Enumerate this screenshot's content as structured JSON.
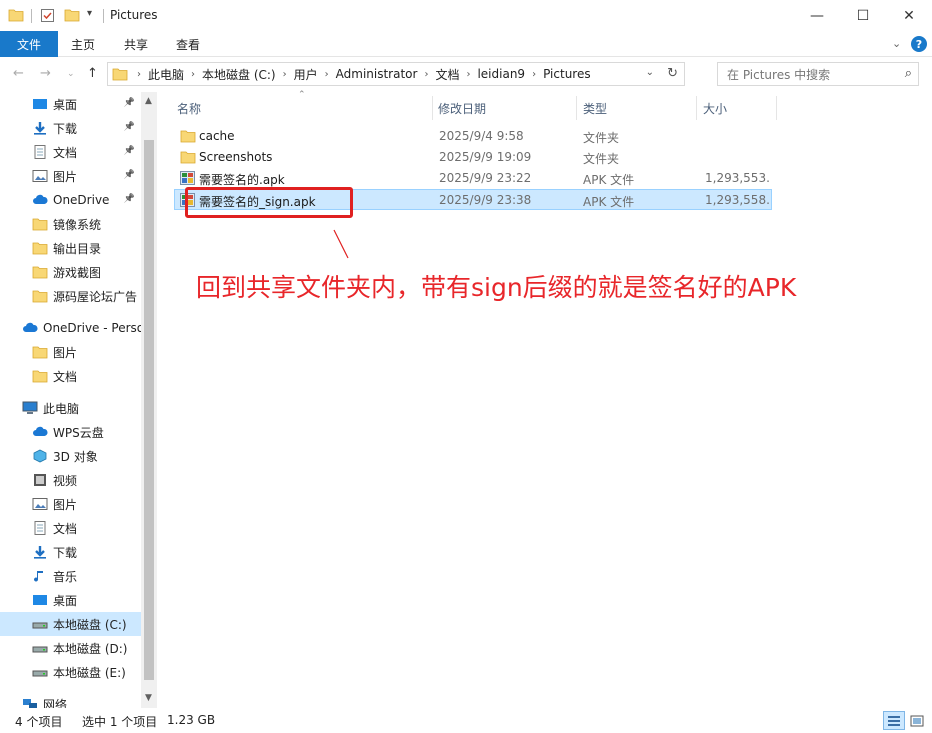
{
  "window": {
    "title": "Pictures",
    "minimize": "—",
    "maximize": "☐",
    "close": "✕"
  },
  "ribbon": {
    "tabs": [
      {
        "label": "文件"
      },
      {
        "label": "主页"
      },
      {
        "label": "共享"
      },
      {
        "label": "查看"
      }
    ],
    "help": "?"
  },
  "address": {
    "crumbs": [
      "此电脑",
      "本地磁盘 (C:)",
      "用户",
      "Administrator",
      "文档",
      "leidian9",
      "Pictures"
    ]
  },
  "search": {
    "placeholder": "在 Pictures 中搜索"
  },
  "sidebar": {
    "items": [
      {
        "label": "桌面",
        "icon": "desktop-icon",
        "pinned": true
      },
      {
        "label": "下载",
        "icon": "download-icon",
        "pinned": true
      },
      {
        "label": "文档",
        "icon": "document-icon",
        "pinned": true
      },
      {
        "label": "图片",
        "icon": "picture-icon",
        "pinned": true
      },
      {
        "label": "OneDrive",
        "icon": "cloud-icon",
        "pinned": true
      },
      {
        "label": "镜像系统",
        "icon": "folder-icon",
        "pinned": false
      },
      {
        "label": "输出目录",
        "icon": "folder-icon",
        "pinned": false
      },
      {
        "label": "游戏截图",
        "icon": "folder-icon",
        "pinned": false
      },
      {
        "label": "源码屋论坛广告",
        "icon": "folder-icon",
        "pinned": false
      },
      {
        "label": "OneDrive - Perso",
        "icon": "cloud-icon",
        "pinned": false
      },
      {
        "label": "图片",
        "icon": "folder-icon",
        "pinned": false
      },
      {
        "label": "文档",
        "icon": "folder-icon",
        "pinned": false
      },
      {
        "label": "此电脑",
        "icon": "computer-icon",
        "pinned": false
      },
      {
        "label": "WPS云盘",
        "icon": "cloud-icon",
        "pinned": false
      },
      {
        "label": "3D 对象",
        "icon": "cube-icon",
        "pinned": false
      },
      {
        "label": "视频",
        "icon": "video-icon",
        "pinned": false
      },
      {
        "label": "图片",
        "icon": "picture-icon",
        "pinned": false
      },
      {
        "label": "文档",
        "icon": "document-icon",
        "pinned": false
      },
      {
        "label": "下载",
        "icon": "download-icon",
        "pinned": false
      },
      {
        "label": "音乐",
        "icon": "music-icon",
        "pinned": false
      },
      {
        "label": "桌面",
        "icon": "desktop-icon",
        "pinned": false
      },
      {
        "label": "本地磁盘 (C:)",
        "icon": "drive-icon",
        "pinned": false,
        "selected": true
      },
      {
        "label": "本地磁盘 (D:)",
        "icon": "drive-icon",
        "pinned": false
      },
      {
        "label": "本地磁盘 (E:)",
        "icon": "drive-icon",
        "pinned": false
      },
      {
        "label": "网络",
        "icon": "network-icon",
        "pinned": false
      }
    ]
  },
  "columns": {
    "name": "名称",
    "date": "修改日期",
    "type": "类型",
    "size": "大小"
  },
  "files": [
    {
      "name": "cache",
      "date": "2025/9/4 9:58",
      "type": "文件夹",
      "size": "",
      "icon": "folder-icon"
    },
    {
      "name": "Screenshots",
      "date": "2025/9/9 19:09",
      "type": "文件夹",
      "size": "",
      "icon": "folder-icon"
    },
    {
      "name": "需要签名的.apk",
      "date": "2025/9/9 23:22",
      "type": "APK 文件",
      "size": "1,293,553...",
      "icon": "apk-icon"
    },
    {
      "name": "需要签名的_sign.apk",
      "date": "2025/9/9 23:38",
      "type": "APK 文件",
      "size": "1,293,558...",
      "icon": "apk-icon",
      "selected": true
    }
  ],
  "annotation": {
    "text": "回到共享文件夹内，带有sign后缀的就是签名好的APK",
    "color": "#e8262a"
  },
  "status": {
    "count": "4 个项目",
    "selection": "选中 1 个项目",
    "size": "1.23 GB"
  },
  "colors": {
    "accent": "#1979ca",
    "selected_bg": "#cce8ff",
    "folder": "#f8d775"
  }
}
